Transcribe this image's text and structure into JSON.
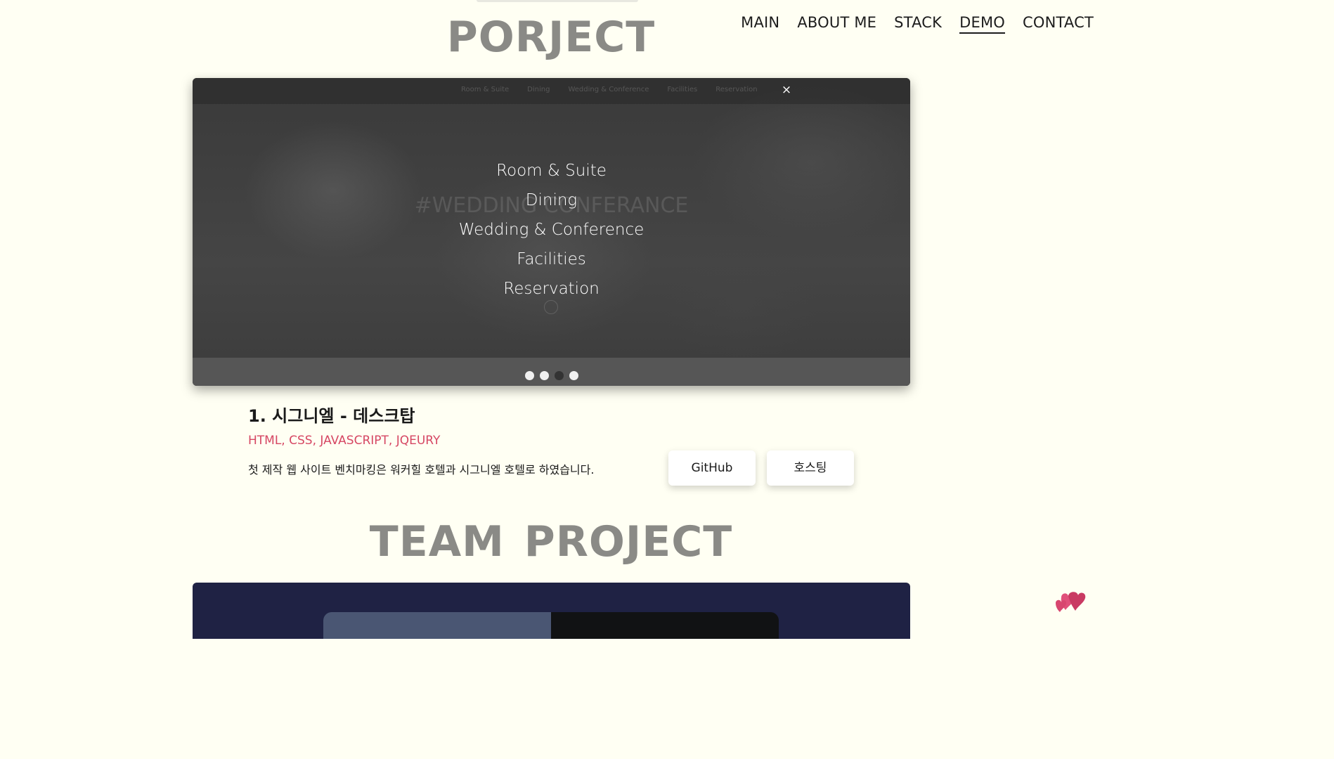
{
  "nav": {
    "items": [
      {
        "label": "MAIN",
        "active": false
      },
      {
        "label": "ABOUT ME",
        "active": false
      },
      {
        "label": "STACK",
        "active": false
      },
      {
        "label": "DEMO",
        "active": true
      },
      {
        "label": "CONTACT",
        "active": false
      }
    ]
  },
  "sections": {
    "project_title": "PORJECT",
    "team_title": "TEAM PROJECT"
  },
  "demo": {
    "ghost_nav": [
      "Room & Suite",
      "Dining",
      "Wedding & Conference",
      "Facilities",
      "Reservation"
    ],
    "close_label": "×",
    "ghost_headline": "#WEDDING CONFERANCE",
    "overlay_menu": [
      "Room & Suite",
      "Dining",
      "Wedding & Conference",
      "Facilities",
      "Reservation"
    ],
    "slide_count": 4,
    "active_slide": 3
  },
  "project": {
    "title": "1. 시그니엘 - 데스크탑",
    "stack": "HTML, CSS, JAVASCRIPT, JQEURY",
    "description": "첫 제작 웹 사이트 벤치마킹은 워커힐 호텔과 시그니엘 호텔로 하였습니다.",
    "github_label": "GitHub",
    "hosting_label": "호스팅"
  },
  "colors": {
    "background": "#fffff3",
    "title_gray": "#8a8a86",
    "stack_accent": "#d64763",
    "team_frame": "#1f2244",
    "heart": "#d6406a"
  },
  "icons": {
    "close": "close-icon",
    "floating": "heart-icon"
  }
}
